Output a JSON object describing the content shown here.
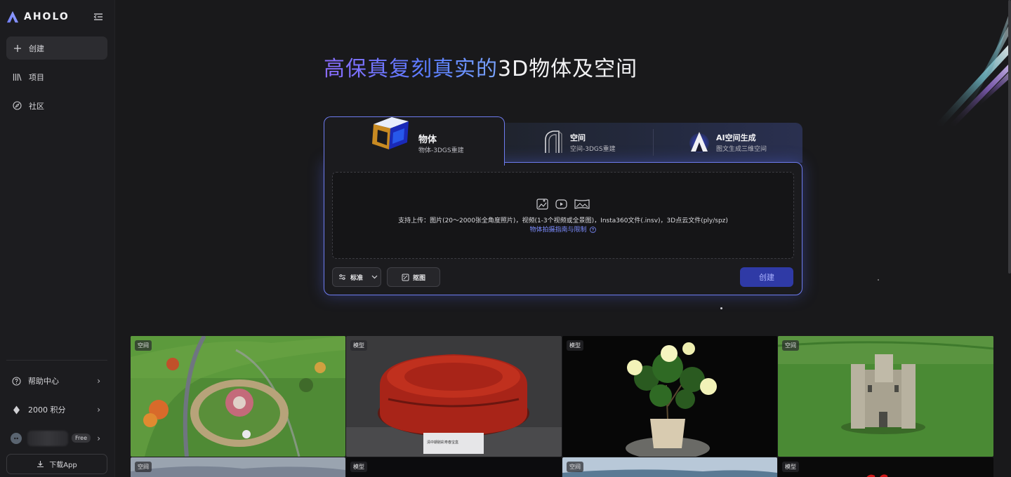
{
  "app": {
    "brand": "AHOLO"
  },
  "sidebar": {
    "nav": [
      {
        "label": "创建",
        "icon": "plus-icon"
      },
      {
        "label": "项目",
        "icon": "library-icon"
      },
      {
        "label": "社区",
        "icon": "compass-icon"
      }
    ],
    "bottom": [
      {
        "label": "帮助中心",
        "icon": "help-circle-icon"
      },
      {
        "label": "2000 积分",
        "icon": "diamond-icon"
      }
    ],
    "user": {
      "plan": "Free"
    },
    "download_label": "下载App"
  },
  "hero": {
    "title_highlight": "高保真复刻真实的",
    "title_rest": "3D物体及空间"
  },
  "tabs": [
    {
      "title": "物体",
      "subtitle": "物体-3DGS重建",
      "active": true
    },
    {
      "title": "空间",
      "subtitle": "空间-3DGS重建",
      "active": false
    },
    {
      "title": "AI空间生成",
      "subtitle": "图文生成三维空间",
      "active": false
    }
  ],
  "upload": {
    "hint": "支持上传：图片(20～2000张全角度照片)，视频(1-3个视频或全景图)，Insta360文件(.insv)，3D点云文件(ply/spz)",
    "guide_link": "物体拍摄指南与限制"
  },
  "controls": {
    "quality_label": "标准",
    "cutout_label": "抠图",
    "create_label": "创建"
  },
  "gallery": [
    {
      "tag": "空间",
      "subject": "park-aerial"
    },
    {
      "tag": "模型",
      "subject": "red-lacquer-box",
      "caption": "清中期剔彩寿春宝盒"
    },
    {
      "tag": "模型",
      "subject": "potted-peony"
    },
    {
      "tag": "空间",
      "subject": "castle-aerial"
    },
    {
      "tag": "空间",
      "subject": "landscape"
    },
    {
      "tag": "模型",
      "subject": "dark-model"
    },
    {
      "tag": "空间",
      "subject": "coast"
    },
    {
      "tag": "模型",
      "subject": "red-object"
    }
  ]
}
